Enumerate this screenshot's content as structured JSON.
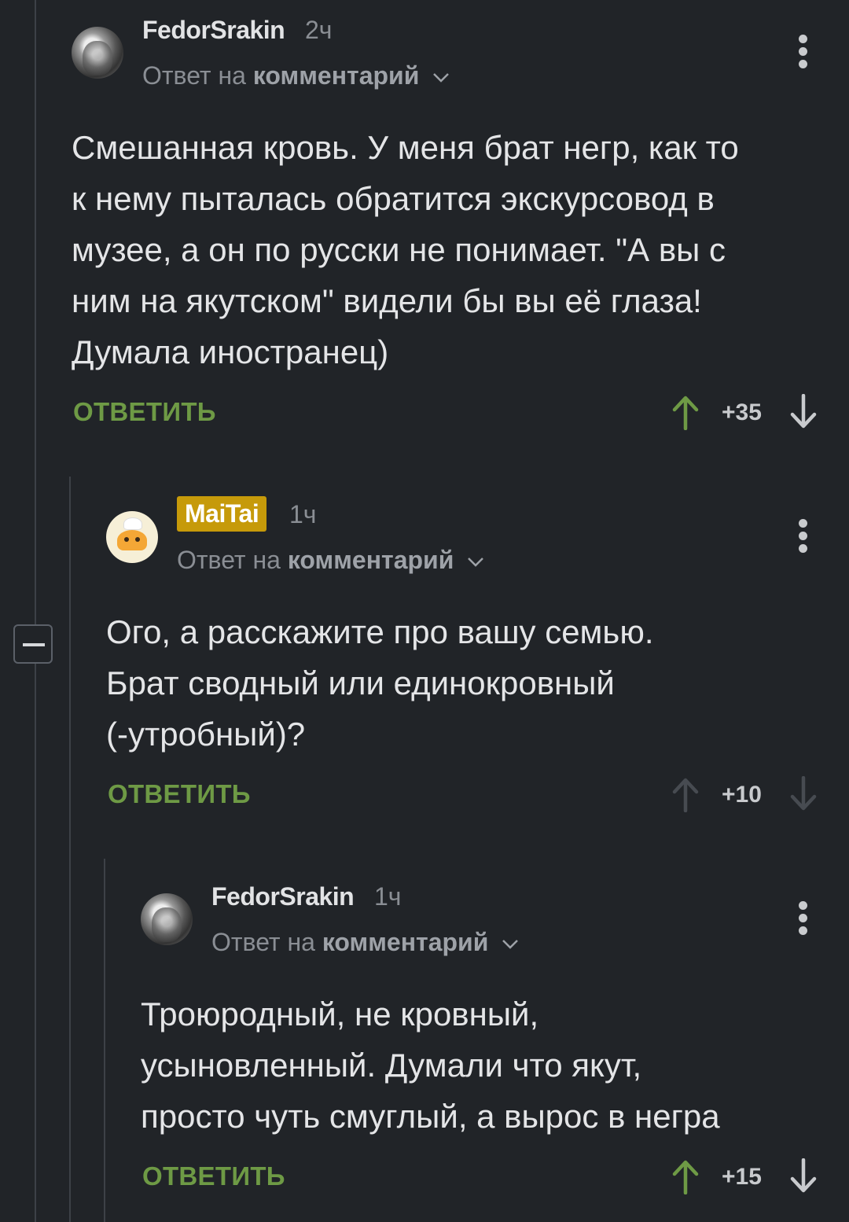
{
  "comments": [
    {
      "username": "FedorSrakin",
      "time": "2ч",
      "reply_prefix": "Ответ на",
      "reply_target": "комментарий",
      "body_lines": [
        "Смешанная кровь. У меня брат негр, как то",
        "к нему пыталась обратится экскурсовод в",
        "музее, а он по русски не понимает. \"А вы с",
        "ним на якутском\" видели бы вы её глаза!",
        "Думала иностранец)"
      ],
      "reply_label": "ОТВЕТИТЬ",
      "score": "+35",
      "upvoted": true
    },
    {
      "username": "MaiTai",
      "time": "1ч",
      "reply_prefix": "Ответ на",
      "reply_target": "комментарий",
      "body_lines": [
        "Ого, а расскажите про вашу семью.",
        "Брат сводный или единокровный",
        "(-утробный)?"
      ],
      "reply_label": "ОТВЕТИТЬ",
      "score": "+10",
      "upvoted": false
    },
    {
      "username": "FedorSrakin",
      "time": "1ч",
      "reply_prefix": "Ответ на",
      "reply_target": "комментарий",
      "body_lines": [
        "Троюродный, не кровный,",
        "усыновленный. Думали что якут,",
        "просто чуть смуглый, а вырос в негра"
      ],
      "reply_label": "ОТВЕТИТЬ",
      "score": "+15",
      "upvoted": true
    }
  ],
  "colors": {
    "background": "#212428",
    "accent_green": "#6e9a45",
    "badge_gold": "#c69a0a",
    "muted": "#8a8e94",
    "thread_line": "#3d4147"
  },
  "icons": {
    "upvote": "arrow-up-icon",
    "downvote": "arrow-down-icon",
    "more": "more-vertical-icon",
    "chevron": "chevron-down-icon",
    "collapse": "collapse-minus-icon"
  }
}
